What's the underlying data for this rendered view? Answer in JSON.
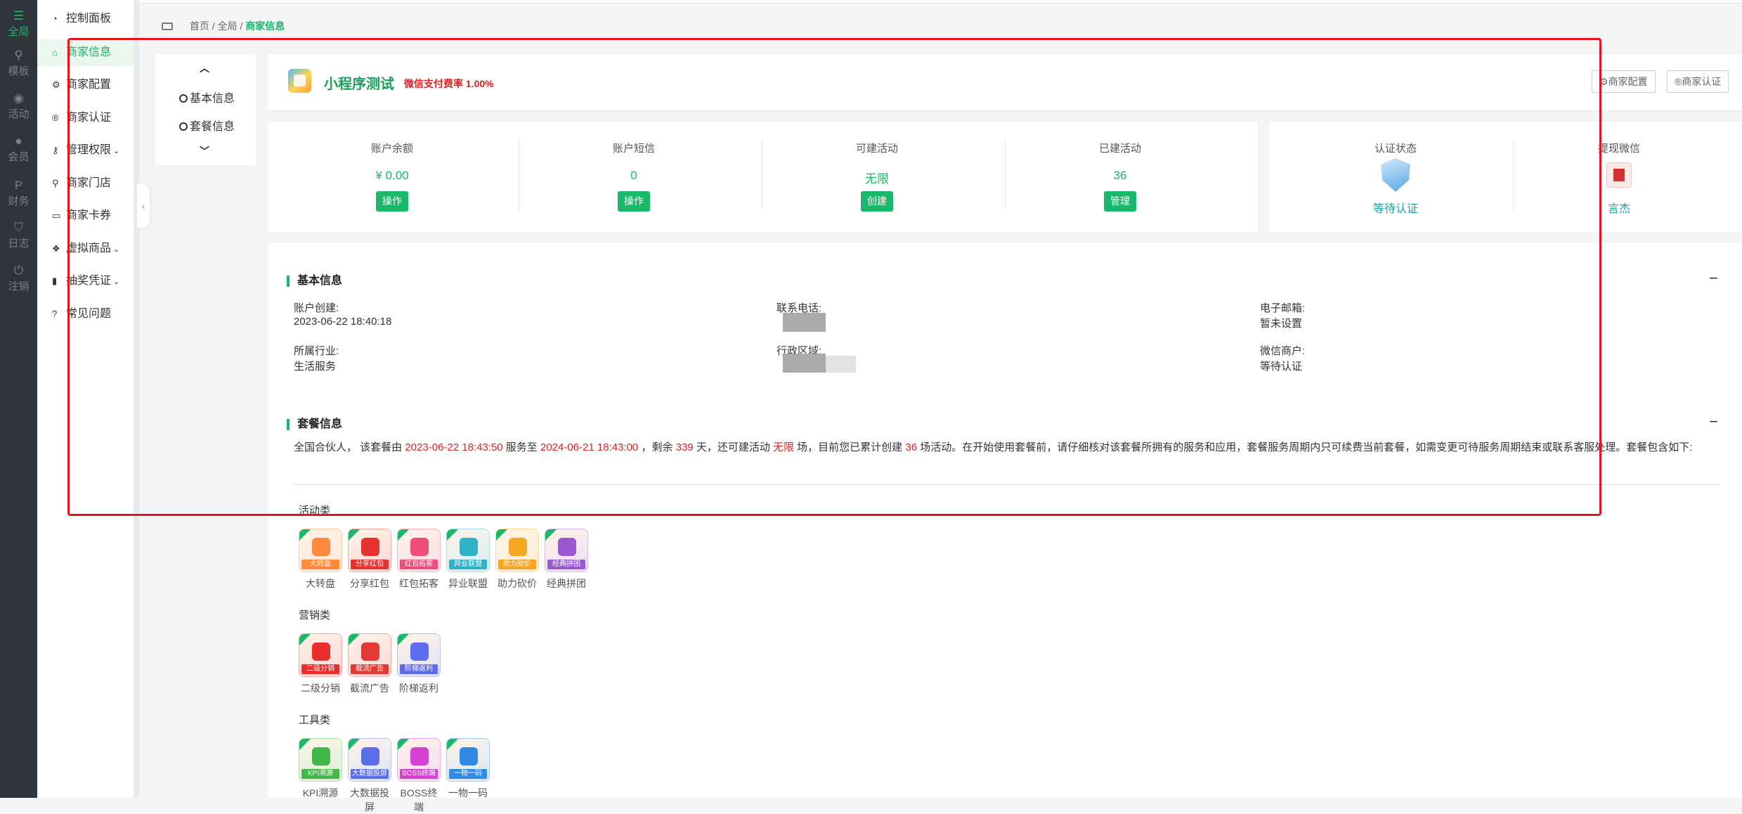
{
  "rail": {
    "items": [
      {
        "label": "全局",
        "icon": "sliders-icon"
      },
      {
        "label": "模板",
        "icon": "sitemap-icon"
      },
      {
        "label": "活动",
        "icon": "podcast-icon"
      },
      {
        "label": "会员",
        "icon": "users-icon"
      },
      {
        "label": "财务",
        "icon": "paypal-icon"
      },
      {
        "label": "日志",
        "icon": "shield-icon"
      },
      {
        "label": "注销",
        "icon": "power-icon"
      }
    ]
  },
  "sidebar": {
    "items": [
      {
        "label": "控制面板",
        "icon": "dashboard-icon"
      },
      {
        "label": "商家信息",
        "icon": "home-icon"
      },
      {
        "label": "商家配置",
        "icon": "cogs-icon"
      },
      {
        "label": "商家认证",
        "icon": "registered-icon"
      },
      {
        "label": "管理权限",
        "icon": "key-icon"
      },
      {
        "label": "商家门店",
        "icon": "map-marker-icon"
      },
      {
        "label": "商家卡券",
        "icon": "credit-card-icon"
      },
      {
        "label": "虚拟商品",
        "icon": "dropbox-icon"
      },
      {
        "label": "抽奖凭证",
        "icon": "bookmark-icon"
      },
      {
        "label": "常见问题",
        "icon": "question-circle-icon"
      }
    ]
  },
  "breadcrumb": {
    "home": "首页",
    "sep1": "/",
    "mid": "全局",
    "sep2": "/",
    "current": "商家信息"
  },
  "anchor_nav": {
    "item1": "基本信息",
    "item2": "套餐信息"
  },
  "header": {
    "store_name": "小程序测试",
    "fee": "微信支付费率 1.00%",
    "btn_config": "商家配置",
    "btn_auth": "商家认证"
  },
  "stats": [
    {
      "label": "账户余额",
      "value": "¥ 0.00",
      "button": "操作"
    },
    {
      "label": "账户短信",
      "value": "0",
      "button": "操作"
    },
    {
      "label": "可建活动",
      "value": "无限",
      "button": "创建"
    },
    {
      "label": "已建活动",
      "value": "36",
      "button": "管理"
    }
  ],
  "status": [
    {
      "label": "认证状态",
      "value": "等待认证"
    },
    {
      "label": "提现微信",
      "value": "言杰"
    }
  ],
  "basic": {
    "title": "基本信息",
    "collapse": "−",
    "created_label": "账户创建:",
    "created_value": "2023-06-22 18:40:18",
    "phone_label": "联系电话:",
    "email_label": "电子邮箱:",
    "email_value": "暂未设置",
    "industry_label": "所属行业:",
    "industry_value": "生活服务",
    "region_label": "行政区域:",
    "merchant_label": "微信商户:",
    "merchant_value": "等待认证"
  },
  "package": {
    "title": "套餐信息",
    "collapse": "−",
    "desc": {
      "p1": "全国合伙人， 该套餐由 ",
      "start": "2023-06-22 18:43:50",
      "p2": " 服务至 ",
      "end": "2024-06-21 18:43:00",
      "p3": " ，剩余 ",
      "days": "339",
      "p4": " 天，还可建活动 ",
      "unlimited": "无限",
      "p5": " 场，目前您已累计创建 ",
      "count": "36",
      "p6": " 场活动。在开始使用套餐前，请仔细核对该套餐所拥有的服务和应用，套餐服务周期内只可续费当前套餐，如需变更可待服务周期结束或联系客服处理。套餐包含如下:"
    },
    "categories": [
      {
        "title": "活动类",
        "apps": [
          {
            "name": "大转盘",
            "band": "大转盘",
            "color": "#ff8a3d"
          },
          {
            "name": "分享红包",
            "band": "分享红包",
            "color": "#e8322f"
          },
          {
            "name": "红包拓客",
            "band": "红包拓客",
            "color": "#ef4e7b"
          },
          {
            "name": "异业联盟",
            "band": "异业联盟",
            "color": "#2fb1c7"
          },
          {
            "name": "助力砍价",
            "band": "助力砍价",
            "color": "#f5a623"
          },
          {
            "name": "经典拼团",
            "band": "经典拼团",
            "color": "#9b59d0"
          }
        ]
      },
      {
        "title": "营销类",
        "apps": [
          {
            "name": "二级分销",
            "band": "二级分销",
            "color": "#ea2e2e"
          },
          {
            "name": "截流广告",
            "band": "截流广告",
            "color": "#e53935"
          },
          {
            "name": "阶梯返利",
            "band": "阶梯返利",
            "color": "#5c6bf0"
          }
        ]
      },
      {
        "title": "工具类",
        "apps": [
          {
            "name": "KPI溯源",
            "band": "KPI溯源",
            "color": "#43b649"
          },
          {
            "name": "大数据投屏",
            "band": "大数据投屏",
            "color": "#5a6ee8"
          },
          {
            "name": "BOSS终端",
            "band": "BOSS终端",
            "color": "#d63fd1"
          },
          {
            "name": "一物一码",
            "band": "一物一码",
            "color": "#2f8be6"
          }
        ]
      }
    ]
  },
  "colors": {
    "accent": "#19b86a",
    "highlight": "#e6151c",
    "danger": "#e02020",
    "rail": "#2f353b"
  }
}
